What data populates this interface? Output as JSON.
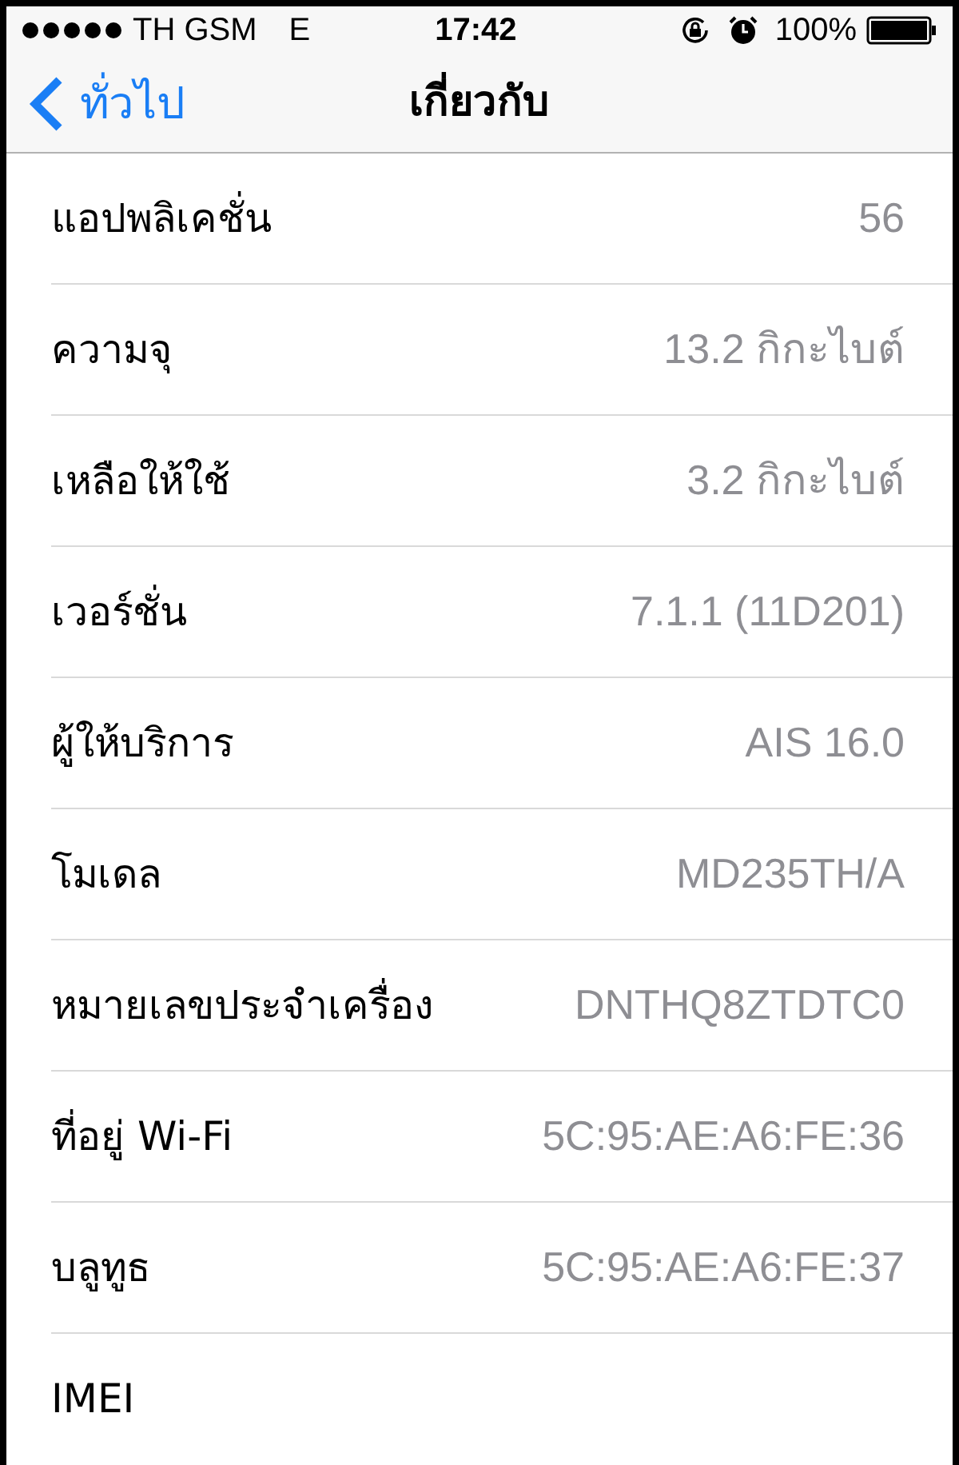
{
  "status_bar": {
    "carrier": "TH GSM",
    "network": "E",
    "time": "17:42",
    "battery": "100%"
  },
  "nav": {
    "back": "ทั่วไป",
    "title": "เกี่ยวกับ"
  },
  "rows": [
    {
      "label": "แอปพลิเคชั่น",
      "value": "56"
    },
    {
      "label": "ความจุ",
      "value": "13.2 กิกะไบต์"
    },
    {
      "label": "เหลือให้ใช้",
      "value": "3.2 กิกะไบต์"
    },
    {
      "label": "เวอร์ชั่น",
      "value": "7.1.1 (11D201)"
    },
    {
      "label": "ผู้ให้บริการ",
      "value": "AIS 16.0"
    },
    {
      "label": "โมเดล",
      "value": "MD235TH/A"
    },
    {
      "label": "หมายเลขประจำเครื่อง",
      "value": "DNTHQ8ZTDTC0"
    },
    {
      "label": "ที่อยู่ Wi-Fi",
      "value": "5C:95:AE:A6:FE:36"
    },
    {
      "label": "บลูทูธ",
      "value": "5C:95:AE:A6:FE:37"
    },
    {
      "label": "IMEI"
    }
  ]
}
